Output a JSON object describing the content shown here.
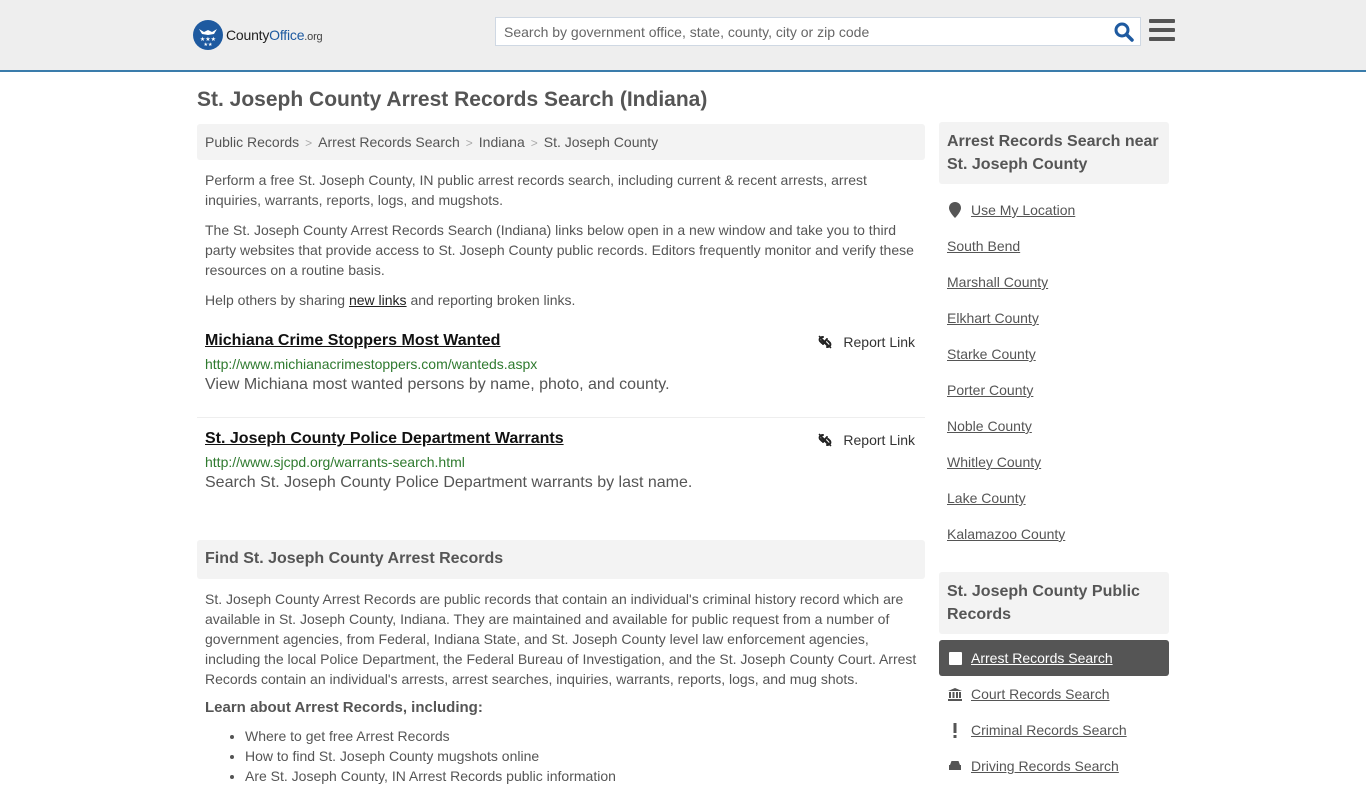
{
  "header": {
    "logo_county": "County",
    "logo_office": "Office",
    "logo_org": ".org",
    "search_placeholder": "Search by government office, state, county, city or zip code",
    "colors": {
      "brand": "#1e5aa0",
      "accent_border": "#3a7cab"
    }
  },
  "page": {
    "title": "St. Joseph County Arrest Records Search (Indiana)"
  },
  "breadcrumb": [
    "Public Records",
    "Arrest Records Search",
    "Indiana",
    "St. Joseph County"
  ],
  "breadcrumb_sep": ">",
  "intro": {
    "p1": "Perform a free St. Joseph County, IN public arrest records search, including current & recent arrests, arrest inquiries, warrants, reports, logs, and mugshots.",
    "p2": "The St. Joseph County Arrest Records Search (Indiana) links below open in a new window and take you to third party websites that provide access to St. Joseph County public records. Editors frequently monitor and verify these resources on a routine basis.",
    "p3_before": "Help others by sharing ",
    "p3_link": "new links",
    "p3_after": " and reporting broken links."
  },
  "links": [
    {
      "title": "Michiana Crime Stoppers Most Wanted",
      "url": "http://www.michianacrimestoppers.com/wanteds.aspx",
      "description": "View Michiana most wanted persons by name, photo, and county.",
      "report_label": "Report Link"
    },
    {
      "title": "St. Joseph County Police Department Warrants",
      "url": "http://www.sjcpd.org/warrants-search.html",
      "description": "Search St. Joseph County Police Department warrants by last name.",
      "report_label": "Report Link"
    }
  ],
  "find": {
    "heading": "Find St. Joseph County Arrest Records",
    "body": "St. Joseph County Arrest Records are public records that contain an individual's criminal history record which are available in St. Joseph County, Indiana. They are maintained and available for public request from a number of government agencies, from Federal, Indiana State, and St. Joseph County level law enforcement agencies, including the local Police Department, the Federal Bureau of Investigation, and the St. Joseph County Court. Arrest Records contain an individual's arrests, arrest searches, inquiries, warrants, reports, logs, and mug shots.",
    "learn_heading": "Learn about Arrest Records, including:",
    "learn_items": [
      "Where to get free Arrest Records",
      "How to find St. Joseph County mugshots online",
      "Are St. Joseph County, IN Arrest Records public information"
    ]
  },
  "sidebar": {
    "near_heading": "Arrest Records Search near St. Joseph County",
    "use_location": "Use My Location",
    "near_items": [
      "South Bend",
      "Marshall County",
      "Elkhart County",
      "Starke County",
      "Porter County",
      "Noble County",
      "Whitley County",
      "Lake County",
      "Kalamazoo County"
    ],
    "public_heading": "St. Joseph County Public Records",
    "public_items": [
      {
        "label": "Arrest Records Search",
        "icon": "square-icon",
        "active": true
      },
      {
        "label": "Court Records Search",
        "icon": "courthouse-icon",
        "active": false
      },
      {
        "label": "Criminal Records Search",
        "icon": "exclamation-icon",
        "active": false
      },
      {
        "label": "Driving Records Search",
        "icon": "car-icon",
        "active": false
      }
    ]
  }
}
